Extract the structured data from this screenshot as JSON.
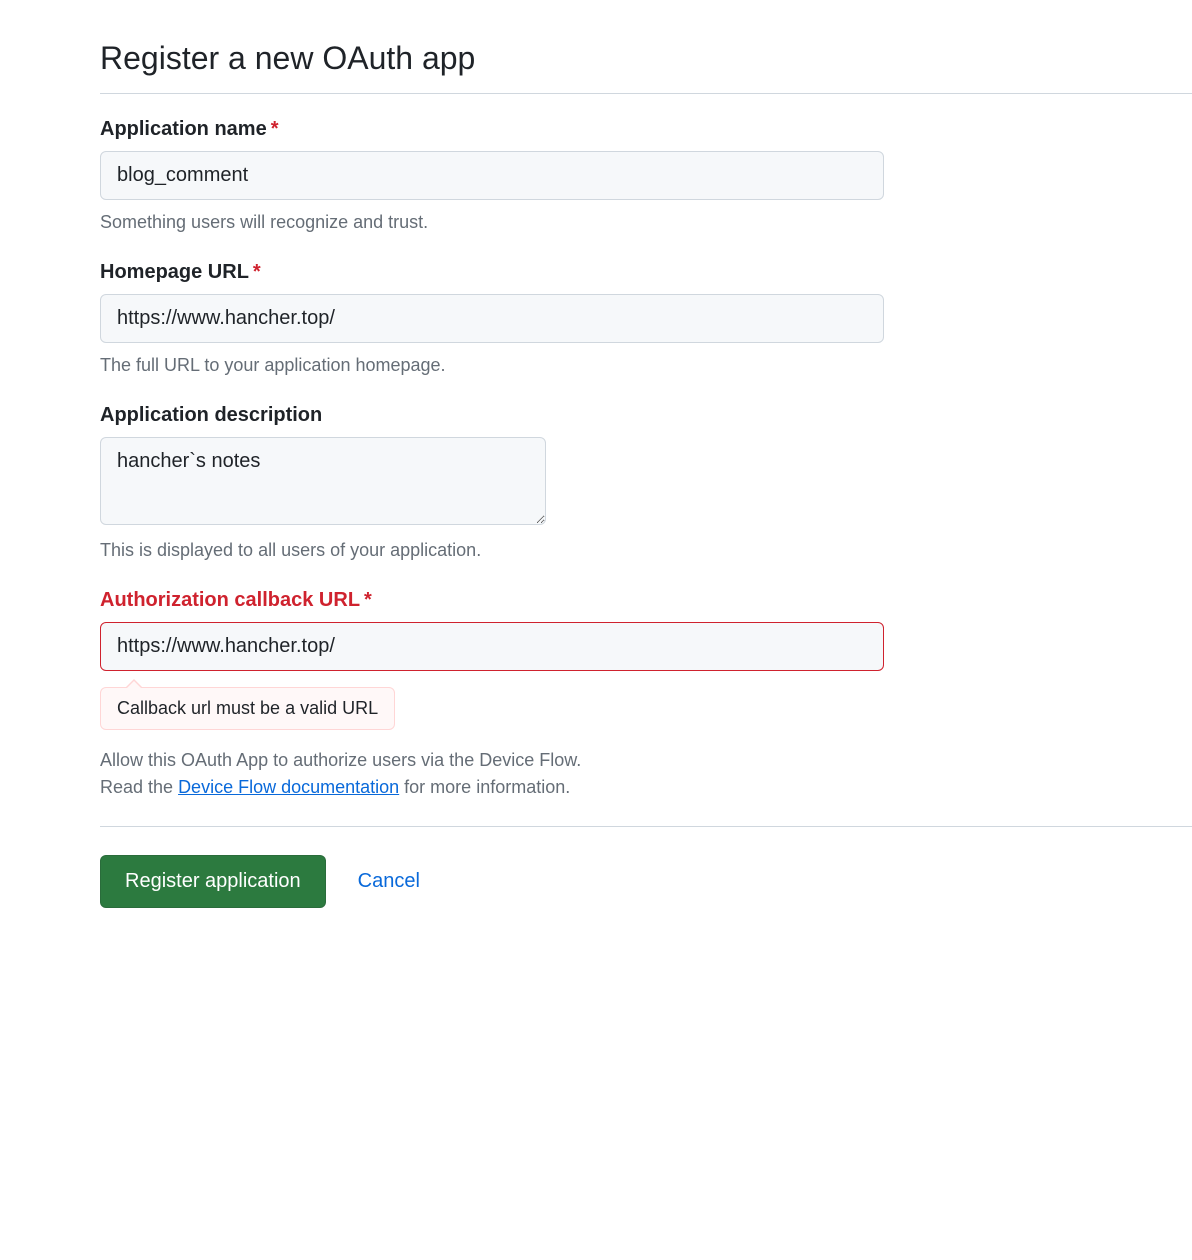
{
  "page": {
    "title": "Register a new OAuth app"
  },
  "form": {
    "app_name": {
      "label": "Application name",
      "value": "blog_comment",
      "help": "Something users will recognize and trust."
    },
    "homepage_url": {
      "label": "Homepage URL",
      "value": "https://www.hancher.top/",
      "help": "The full URL to your application homepage."
    },
    "description": {
      "label": "Application description",
      "value": "hancher`s notes",
      "help": "This is displayed to all users of your application."
    },
    "callback_url": {
      "label": "Authorization callback URL",
      "value": "https://www.hancher.top/",
      "error": "Callback url must be a valid URL"
    },
    "device_flow": {
      "line1": "Allow this OAuth App to authorize users via the Device Flow.",
      "line2_prefix": "Read the ",
      "link_text": "Device Flow documentation",
      "line2_suffix": " for more information."
    },
    "buttons": {
      "submit": "Register application",
      "cancel": "Cancel"
    }
  }
}
